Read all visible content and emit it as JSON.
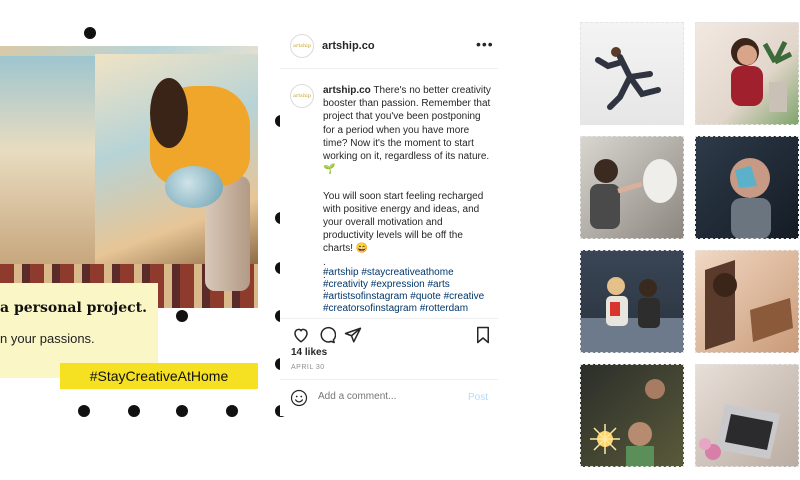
{
  "creative": {
    "title": "a personal project.",
    "subtitle": "n your passions.",
    "hashtag": "#StayCreativeAtHome"
  },
  "post": {
    "username": "artship.co",
    "avatar_text": "artship",
    "caption_user": "artship.co",
    "caption_text": " There's no better creativity booster than passion. Remember that project that you've been postponing for a period when you have more time? Now it's the moment to start working on it, regardless of its nature. 🌱\n\nYou will soon start feeling recharged with positive energy and ideas, and your overall motivation and productivity levels will be off the charts! 😄\n.\n.\n.",
    "hashtags": "#artship #staycreativeathome #creativity #expression #arts #artistsofinstagram #quote #creative #creatorsofinstagram #rotterdam",
    "likes": "14 likes",
    "date": "APRIL 30",
    "comment_placeholder": "Add a comment...",
    "post_label": "Post"
  },
  "grid": {
    "tiles": [
      {
        "label": "dancer-jumping-photo"
      },
      {
        "label": "woman-with-plants-photo"
      },
      {
        "label": "sculptor-with-bust-photo"
      },
      {
        "label": "face-paint-portrait-photo"
      },
      {
        "label": "couple-watching-tv-photo"
      },
      {
        "label": "woman-reading-book-photo"
      },
      {
        "label": "friends-with-sparklers-photo"
      },
      {
        "label": "laptop-typing-photo"
      }
    ]
  },
  "colors": {
    "accent_yellow": "#f5e021",
    "caption_bg": "#fbf6c6",
    "hashtag_link": "#00376b",
    "post_disabled": "#b3dbff"
  }
}
